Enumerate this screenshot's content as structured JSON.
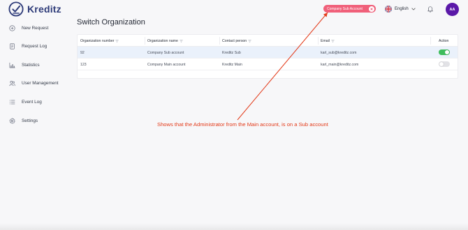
{
  "app": {
    "logo_text": "Kreditz"
  },
  "sidebar": {
    "items": [
      {
        "label": "New Request",
        "icon": "plus-circle-icon"
      },
      {
        "label": "Request Log",
        "icon": "document-icon"
      },
      {
        "label": "Statistics",
        "icon": "bar-chart-icon"
      },
      {
        "label": "User Management",
        "icon": "users-icon"
      },
      {
        "label": "Event Log",
        "icon": "list-icon"
      },
      {
        "label": "Settings",
        "icon": "gear-icon"
      }
    ]
  },
  "header": {
    "org_pill_label": "Company Sub Account",
    "org_pill_color": "#f0607a",
    "language": "English",
    "avatar_initials": "AA",
    "avatar_color": "#5a18a8"
  },
  "main": {
    "title": "Switch Organization",
    "table": {
      "headers": [
        "Organization number",
        "Organization name",
        "Contact person",
        "Email",
        "Action"
      ],
      "rows": [
        {
          "org_number": "92",
          "org_name": "Company Sub account",
          "contact": "Kreditz Sub",
          "email": "karl_sub@kreditz.com",
          "active": true
        },
        {
          "org_number": "123",
          "org_name": "Company Main account",
          "contact": "Kreditz Main",
          "email": "karl_main@kreditz.com",
          "active": false
        }
      ]
    }
  },
  "annotation": {
    "text": "Shows that the Administrator from the Main account, is on a Sub account",
    "color": "#e33b1a"
  }
}
